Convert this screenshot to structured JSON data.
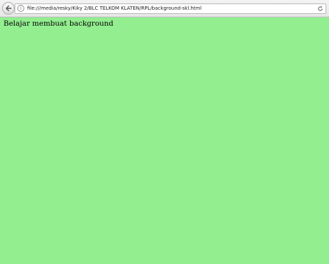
{
  "toolbar": {
    "back_icon": "back-arrow-icon",
    "info_icon": "info-icon",
    "info_glyph": "i",
    "reload_icon": "reload-icon"
  },
  "address_bar": {
    "url": "file:///media/resky/Kiky 2/BLC TELKOM KLATEN/RPL/background-skl.html"
  },
  "page": {
    "background_color": "#93ee90",
    "text": "Belajar membuat background"
  }
}
